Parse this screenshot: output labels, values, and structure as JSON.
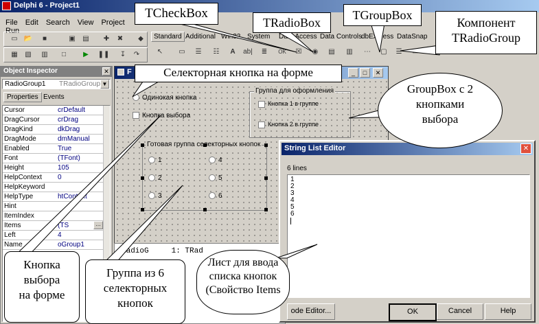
{
  "ide": {
    "title": "Delphi 6 - Project1",
    "menu": [
      "File",
      "Edit",
      "Search",
      "View",
      "Project",
      "Run"
    ],
    "palette_tabs": [
      "Standard",
      "Additional",
      "Win32",
      "System",
      "Data Access",
      "Data Controls",
      "dbExpress",
      "DataSnap"
    ]
  },
  "object_inspector": {
    "title": "Object Inspector",
    "selected_object": "RadioGroup1",
    "selected_type": "TRadioGroup",
    "tabs": [
      "Properties",
      "Events"
    ],
    "rows": [
      {
        "k": "Cursor",
        "v": "crDefault"
      },
      {
        "k": "DragCursor",
        "v": "crDrag"
      },
      {
        "k": "DragKind",
        "v": "dkDrag"
      },
      {
        "k": "DragMode",
        "v": "dmManual"
      },
      {
        "k": "Enabled",
        "v": "True"
      },
      {
        "k": "Font",
        "v": "(TFont)"
      },
      {
        "k": "Height",
        "v": "105"
      },
      {
        "k": "HelpContext",
        "v": "0"
      },
      {
        "k": "HelpKeyword",
        "v": ""
      },
      {
        "k": "HelpType",
        "v": "htContext"
      },
      {
        "k": "Hint",
        "v": ""
      },
      {
        "k": "ItemIndex",
        "v": "-1"
      },
      {
        "k": "Items",
        "v": "(TS"
      },
      {
        "k": "Left",
        "v": "4"
      },
      {
        "k": "Name",
        "v": "oGroup1"
      }
    ]
  },
  "form": {
    "title_fragment": "F",
    "single_radio": "Одинокая кнопка",
    "checkbox": "Кнопка выбора",
    "groupbox_caption": "Группа для оформления",
    "groupbox_items": [
      "Кнопка 1 в группе",
      "Кнопка 2 в группе"
    ],
    "radiogroup_caption": "Готовая группа селекторных кнопок",
    "radiogroup_items": [
      "1",
      "2",
      "3",
      "4",
      "5",
      "6"
    ]
  },
  "code_editor": {
    "line": "RadioG     1: TRad"
  },
  "string_list_editor": {
    "title": "String List Editor",
    "count": "6 lines",
    "lines": [
      "1",
      "2",
      "3",
      "4",
      "5",
      "6"
    ],
    "buttons": {
      "code": "ode Editor...",
      "ok": "OK",
      "cancel": "Cancel",
      "help": "Help"
    }
  },
  "callouts": {
    "tcheckbox": "TCheckBox",
    "tradiobox": "TRadioBox",
    "tgroupbox": "TGroupBox",
    "component": "Компонент",
    "tradiogroup": "TRadioGroup",
    "form_radio": "Селекторная кнопка на форме",
    "groupbox_desc_1": "GroupBox с 2",
    "groupbox_desc_2": "кнопками",
    "groupbox_desc_3": "выбора",
    "checkbox_desc_1": "Кнопка",
    "checkbox_desc_2": "выбора",
    "checkbox_desc_3": "на форме",
    "group6_1": "Группа из 6",
    "group6_2": "селекторных",
    "group6_3": "кнопок",
    "list_1": "Лист для ввода",
    "list_2": "списка кнопок",
    "list_3": "(Свойство Items"
  }
}
